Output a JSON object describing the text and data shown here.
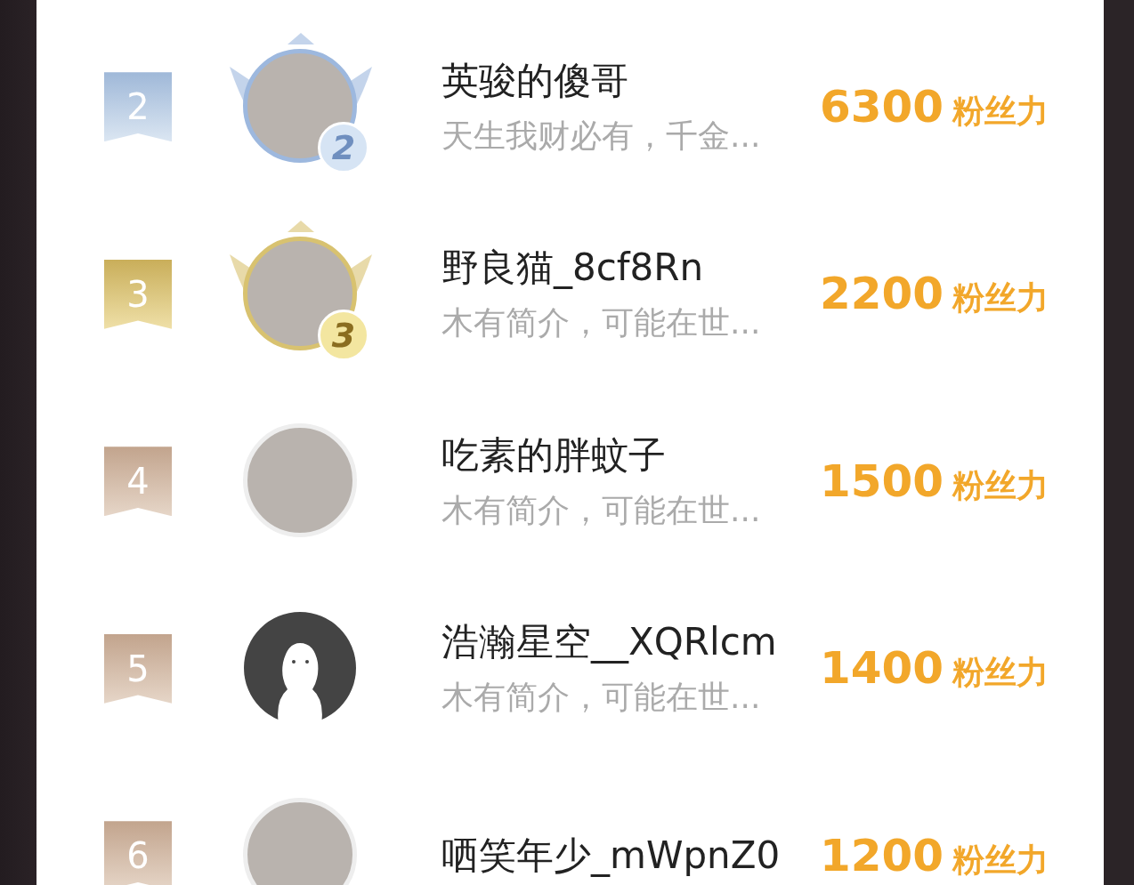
{
  "ranking": [
    {
      "rank": "2",
      "kind": "silver",
      "frame_number": "2",
      "default_avatar": false,
      "name": "英骏的傻哥",
      "bio": "天生我财必有，千金...",
      "score": "6300",
      "score_unit": "粉丝力"
    },
    {
      "rank": "3",
      "kind": "gold",
      "frame_number": "3",
      "default_avatar": false,
      "name": "野良猫_8cf8Rn",
      "bio": "木有简介，可能在世...",
      "score": "2200",
      "score_unit": "粉丝力"
    },
    {
      "rank": "4",
      "kind": "plain",
      "default_avatar": false,
      "name": "吃素的胖蚊子",
      "bio": "木有简介，可能在世...",
      "score": "1500",
      "score_unit": "粉丝力"
    },
    {
      "rank": "5",
      "kind": "plain",
      "default_avatar": true,
      "name": "浩瀚星空__XQRlcm",
      "bio": "木有简介，可能在世...",
      "score": "1400",
      "score_unit": "粉丝力"
    },
    {
      "rank": "6",
      "kind": "plain",
      "default_avatar": false,
      "name": "哂笑年少_mWpnZ0",
      "score": "1200",
      "score_unit": "粉丝力"
    }
  ]
}
